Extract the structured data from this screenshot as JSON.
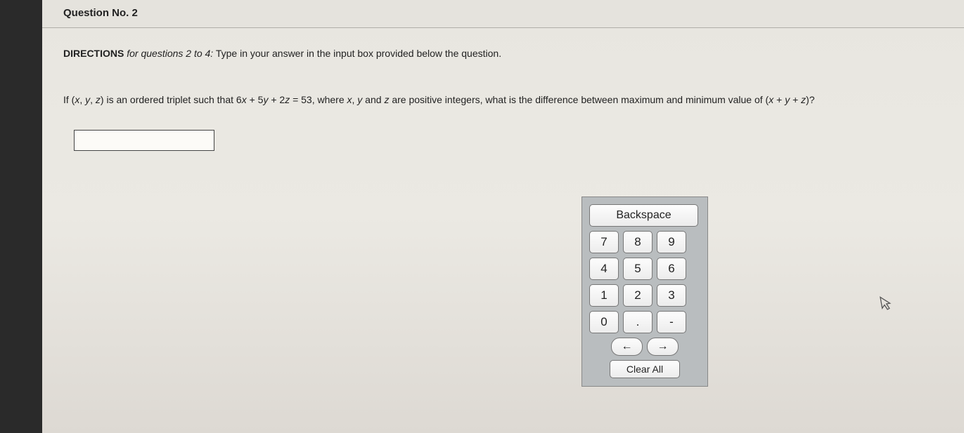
{
  "header": {
    "title": "Question No. 2"
  },
  "directions": {
    "label": "DIRECTIONS",
    "range": " for questions 2 to 4:",
    "text": " Type in your answer in the input box provided below the question."
  },
  "question": {
    "prefix": "If (",
    "v1": "x",
    "c1": ", ",
    "v2": "y",
    "c2": ", ",
    "v3": "z",
    "mid1": ") is an ordered triplet such that 6",
    "v4": "x",
    "plus1": " + 5",
    "v5": "y",
    "plus2": " + 2",
    "v6": "z",
    "mid2": " = 53, where ",
    "v7": "x",
    "c3": ", ",
    "v8": "y",
    "and": " and ",
    "v9": "z",
    "mid3": " are positive integers, what is the difference between maximum and minimum value of (",
    "v10": "x",
    "plus3": " + ",
    "v11": "y",
    "plus4": " + ",
    "v12": "z",
    "end": ")?"
  },
  "input": {
    "value": ""
  },
  "keypad": {
    "backspace": "Backspace",
    "k7": "7",
    "k8": "8",
    "k9": "9",
    "k4": "4",
    "k5": "5",
    "k6": "6",
    "k1": "1",
    "k2": "2",
    "k3": "3",
    "k0": "0",
    "dot": ".",
    "minus": "-",
    "left": "←",
    "right": "→",
    "clear": "Clear All"
  }
}
